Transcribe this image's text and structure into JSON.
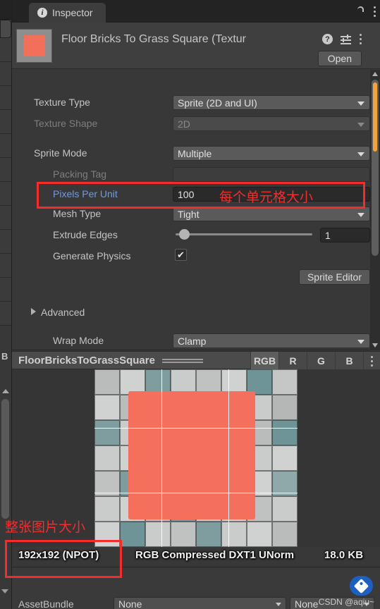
{
  "window": {
    "tab_label": "Inspector",
    "info_icon": "info-icon",
    "lock_icon": "lock-icon",
    "menu_icon": "kebab-menu-icon"
  },
  "object_header": {
    "title": "Floor Bricks To Grass Square (Textur",
    "help_icon": "help-icon",
    "preset_icon": "preset-settings-icon",
    "menu_icon": "kebab-menu-icon",
    "open_button": "Open",
    "thumbnail": "texture-thumbnail"
  },
  "properties": [
    {
      "label": "Texture Type",
      "value": "Sprite (2D and UI)",
      "control": "dropdown"
    },
    {
      "label": "Texture Shape",
      "value": "2D",
      "control": "dropdown-disabled"
    },
    {
      "label": "Sprite Mode",
      "value": "Multiple",
      "control": "dropdown"
    },
    {
      "label": "Packing Tag",
      "value": "",
      "control": "textfield-disabled"
    },
    {
      "label": "Pixels Per Unit",
      "value": "100",
      "control": "textfield"
    },
    {
      "label": "Mesh Type",
      "value": "Tight",
      "control": "dropdown"
    },
    {
      "label": "Extrude Edges",
      "value": "1",
      "control": "slider"
    },
    {
      "label": "Generate Physics",
      "value": "✔",
      "control": "checkbox"
    }
  ],
  "sprite_editor_button": "Sprite Editor",
  "advanced_foldout": "Advanced",
  "wrap_mode": {
    "label": "Wrap Mode",
    "value": "Clamp"
  },
  "preview": {
    "title": "FloorBricksToGrassSquare",
    "channels": [
      "RGB",
      "R",
      "G",
      "B"
    ],
    "active_channel": "RGB",
    "menu_icon": "kebab-menu-icon"
  },
  "status": {
    "size": "192x192 (NPOT)",
    "format": "RGB Compressed DXT1 UNorm",
    "filesize": "18.0 KB"
  },
  "bottom": {
    "assetbundle_label": "AssetBundle",
    "assetbundle_value": "None",
    "variant_value": "None"
  },
  "annotations": [
    {
      "text": "每个单元格大小",
      "name": "annotation-cell-size"
    },
    {
      "text": "整张图片大小",
      "name": "annotation-image-size"
    }
  ],
  "watermark": {
    "text": "CSDN @aqiu~",
    "badge_icon": "tag-badge-icon"
  },
  "left_panel": {
    "partial_label_top": "B",
    "partial_label_bottom": "AssetBundle"
  },
  "colors": {
    "accent_red": "#f42c2c",
    "scroll_highlight": "#f2a33c",
    "link_blue": "#6c9ce8",
    "sprite_orange": "#f4705c"
  }
}
